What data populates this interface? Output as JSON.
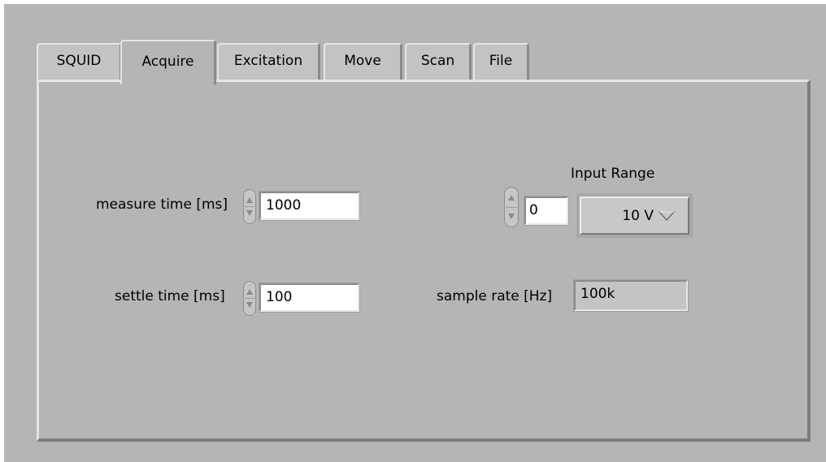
{
  "tabs": [
    {
      "label": "SQUID",
      "active": false
    },
    {
      "label": "Acquire",
      "active": true
    },
    {
      "label": "Excitation",
      "active": false
    },
    {
      "label": "Move",
      "active": false
    },
    {
      "label": "Scan",
      "active": false
    },
    {
      "label": "File",
      "active": false
    }
  ],
  "acquire": {
    "measure_time": {
      "label": "measure time [ms]",
      "value": "1000"
    },
    "settle_time": {
      "label": "settle time [ms]",
      "value": "100"
    },
    "input_range": {
      "label": "Input Range",
      "index": "0",
      "selected": "10 V"
    },
    "sample_rate": {
      "label": "sample rate [Hz]",
      "value": "100k"
    }
  }
}
